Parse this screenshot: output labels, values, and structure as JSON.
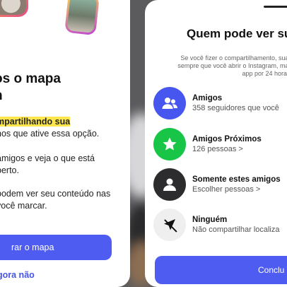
{
  "left": {
    "title_lines": [
      "os o mapa",
      "n"
    ],
    "item1": {
      "highlight": "mpartilhando sua",
      "rest": "nos que ative essa opção."
    },
    "item2_lines": [
      "amigos e veja o que está",
      "perto."
    ],
    "item3_lines": [
      "podem ver seu conteúdo nas",
      "você marcar."
    ],
    "primary_button": "rar o mapa",
    "secondary_link": "gora não"
  },
  "right": {
    "title": "Quem pode ver su",
    "description_lines": [
      "Se você fizer o compartilhamento, sua l",
      "sempre que você abrir o Instagram, mas",
      "app por 24 horas."
    ],
    "options": [
      {
        "label": "Amigos",
        "sublabel": "358 seguidores que você",
        "icon": "friends-icon",
        "color": "#4756ee"
      },
      {
        "label": "Amigos Próximos",
        "sublabel": "126 pessoas  >",
        "icon": "star-icon",
        "color": "#19c547"
      },
      {
        "label": "Somente estes amigos",
        "sublabel": "Escolher pessoas  >",
        "icon": "person-icon",
        "color": "#2c2c2e"
      },
      {
        "label": "Ninguém",
        "sublabel": "Não compartilhar localiza",
        "icon": "location-off-icon",
        "color": "#efefef"
      }
    ],
    "button": "Conclu"
  }
}
